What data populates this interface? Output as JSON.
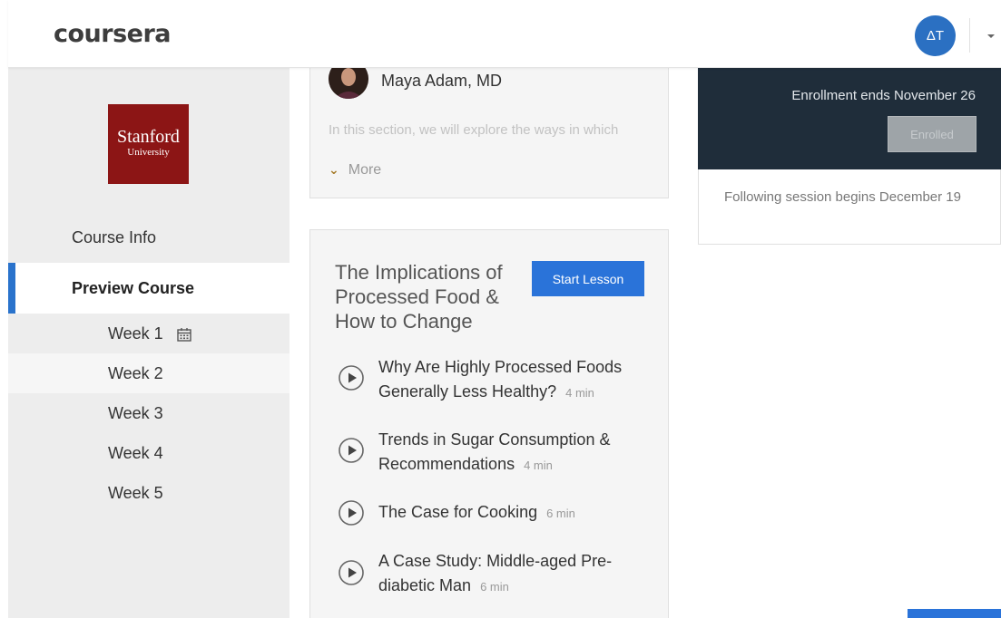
{
  "header": {
    "logo": "coursera",
    "avatar_initials": "ΔT"
  },
  "sidebar": {
    "university": {
      "line1": "Stanford",
      "line2": "University"
    },
    "course_info": "Course Info",
    "preview_course": "Preview Course",
    "weeks": [
      "Week 1",
      "Week 2",
      "Week 3",
      "Week 4",
      "Week 5"
    ]
  },
  "instructor": {
    "name": "Maya Adam, MD",
    "intro": "In this section, we will explore the ways in which",
    "more": "More"
  },
  "lesson": {
    "title": "The Implications of Processed Food & How to Change",
    "start_button": "Start Lesson",
    "items": [
      {
        "title": "Why Are Highly Processed Foods Generally Less Healthy?",
        "duration": "4 min"
      },
      {
        "title": "Trends in Sugar Consumption & Recommendations",
        "duration": "4 min"
      },
      {
        "title": "The Case for Cooking",
        "duration": "6 min"
      },
      {
        "title": "A Case Study: Middle-aged Pre-diabetic Man",
        "duration": "6 min"
      }
    ]
  },
  "enrollment": {
    "ends_text": "Enrollment ends November 26",
    "enrolled_button": "Enrolled",
    "following_session": "Following session begins December 19"
  },
  "colors": {
    "brand_blue": "#2a73d9",
    "stanford_red": "#8c1515",
    "dark_panel": "#1f2d3a"
  },
  "icons": {
    "play": "play-circle-icon",
    "calendar": "calendar-icon",
    "chevron": "chevron-down-icon",
    "caret": "caret-down-icon"
  }
}
